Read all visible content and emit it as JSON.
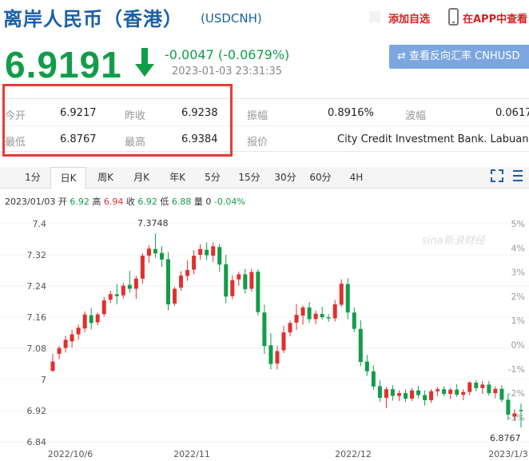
{
  "header": {
    "title": "离岸人民币（香港）",
    "code": "(USDCNH)",
    "add_favorite": "添加自选",
    "app_link": "在APP中查看"
  },
  "price": {
    "last": "6.9191",
    "change": "-0.0047 (-0.0679%)",
    "timestamp": "2023-01-03 23:31:35",
    "direction": "down"
  },
  "reverse_button": "⇄ 查看反向汇率 CNHUSD",
  "quote": {
    "open_label": "今开",
    "open": "6.9217",
    "prev_close_label": "昨收",
    "prev_close": "6.9238",
    "amplitude_label": "振幅",
    "amplitude": "0.8916%",
    "volatility_label": "波幅",
    "volatility": "0.0617",
    "low_label": "最低",
    "low": "6.8767",
    "high_label": "最高",
    "high": "6.9384",
    "quote_label": "报价",
    "quoter": "City Credit Investment Bank. Labuan"
  },
  "tabs": [
    "1分",
    "日K",
    "周K",
    "月K",
    "年K",
    "5分",
    "15分",
    "30分",
    "60分",
    "4H"
  ],
  "active_tab": 1,
  "ohlc_bar": {
    "date": "2023/01/03",
    "open_label": "开",
    "open": "6.92",
    "high_label": "高",
    "high": "6.94",
    "close_label": "收",
    "close": "6.92",
    "low_label": "低",
    "low": "6.88",
    "vol_label": "量",
    "vol": "0",
    "pct": "-0.04%"
  },
  "colors": {
    "up": "#e03030",
    "down": "#129c4a",
    "accent": "#1a5fa8"
  },
  "chart_data": {
    "type": "candlestick",
    "y_ticks": [
      "7.4",
      "7.32",
      "7.24",
      "7.16",
      "7.08",
      "7",
      "6.92",
      "6.84"
    ],
    "pct_ticks": [
      "5%",
      "4%",
      "3%",
      "2%",
      "1%",
      "0%",
      "-1%",
      "-2%",
      "-3%"
    ],
    "x_ticks": [
      "2022/10/6",
      "2022/11",
      "2022/12",
      "2023/1/3"
    ],
    "max_label": "7.3748",
    "min_label": "6.8767",
    "watermark": "sina新浪财经",
    "ylim": [
      6.84,
      7.4
    ],
    "candles": [
      [
        7.022,
        7.066,
        7.02,
        7.046
      ],
      [
        7.066,
        7.086,
        7.052,
        7.081
      ],
      [
        7.081,
        7.112,
        7.069,
        7.102
      ],
      [
        7.098,
        7.128,
        7.082,
        7.116
      ],
      [
        7.116,
        7.141,
        7.102,
        7.133
      ],
      [
        7.131,
        7.175,
        7.122,
        7.167
      ],
      [
        7.165,
        7.183,
        7.129,
        7.145
      ],
      [
        7.147,
        7.172,
        7.139,
        7.167
      ],
      [
        7.168,
        7.212,
        7.161,
        7.203
      ],
      [
        7.205,
        7.228,
        7.196,
        7.219
      ],
      [
        7.219,
        7.245,
        7.193,
        7.214
      ],
      [
        7.216,
        7.248,
        7.208,
        7.241
      ],
      [
        7.243,
        7.279,
        7.223,
        7.233
      ],
      [
        7.233,
        7.266,
        7.207,
        7.259
      ],
      [
        7.259,
        7.324,
        7.246,
        7.318
      ],
      [
        7.318,
        7.345,
        7.3,
        7.336
      ],
      [
        7.335,
        7.375,
        7.313,
        7.324
      ],
      [
        7.325,
        7.342,
        7.289,
        7.308
      ],
      [
        7.309,
        7.327,
        7.178,
        7.193
      ],
      [
        7.195,
        7.238,
        7.189,
        7.233
      ],
      [
        7.236,
        7.278,
        7.228,
        7.267
      ],
      [
        7.266,
        7.306,
        7.253,
        7.281
      ],
      [
        7.282,
        7.332,
        7.27,
        7.318
      ],
      [
        7.32,
        7.347,
        7.308,
        7.335
      ],
      [
        7.333,
        7.352,
        7.307,
        7.319
      ],
      [
        7.318,
        7.352,
        7.302,
        7.342
      ],
      [
        7.34,
        7.348,
        7.276,
        7.295
      ],
      [
        7.296,
        7.32,
        7.196,
        7.213
      ],
      [
        7.214,
        7.268,
        7.206,
        7.255
      ],
      [
        7.257,
        7.277,
        7.241,
        7.27
      ],
      [
        7.27,
        7.284,
        7.221,
        7.232
      ],
      [
        7.233,
        7.284,
        7.226,
        7.276
      ],
      [
        7.277,
        7.283,
        7.165,
        7.173
      ],
      [
        7.172,
        7.192,
        7.066,
        7.086
      ],
      [
        7.088,
        7.119,
        7.026,
        7.04
      ],
      [
        7.041,
        7.087,
        7.026,
        7.073
      ],
      [
        7.075,
        7.138,
        7.068,
        7.121
      ],
      [
        7.121,
        7.151,
        7.111,
        7.145
      ],
      [
        7.146,
        7.194,
        7.127,
        7.166
      ],
      [
        7.164,
        7.19,
        7.141,
        7.185
      ],
      [
        7.185,
        7.199,
        7.146,
        7.155
      ],
      [
        7.155,
        7.177,
        7.142,
        7.169
      ],
      [
        7.168,
        7.186,
        7.154,
        7.16
      ],
      [
        7.16,
        7.168,
        7.148,
        7.157
      ],
      [
        7.157,
        7.204,
        7.149,
        7.193
      ],
      [
        7.192,
        7.257,
        7.186,
        7.246
      ],
      [
        7.245,
        7.26,
        7.155,
        7.172
      ],
      [
        7.172,
        7.185,
        7.122,
        7.13
      ],
      [
        7.13,
        7.152,
        7.034,
        7.045
      ],
      [
        7.046,
        7.063,
        7.009,
        7.021
      ],
      [
        7.021,
        7.036,
        6.973,
        6.982
      ],
      [
        6.983,
        6.998,
        6.943,
        6.953
      ],
      [
        6.953,
        6.981,
        6.926,
        6.975
      ],
      [
        6.975,
        6.985,
        6.946,
        6.958
      ],
      [
        6.958,
        6.972,
        6.945,
        6.965
      ],
      [
        6.965,
        6.975,
        6.943,
        6.951
      ],
      [
        6.951,
        6.978,
        6.945,
        6.972
      ],
      [
        6.972,
        6.984,
        6.952,
        6.96
      ],
      [
        6.96,
        6.972,
        6.933,
        6.947
      ],
      [
        6.947,
        6.975,
        6.94,
        6.97
      ],
      [
        6.97,
        6.98,
        6.957,
        6.975
      ],
      [
        6.975,
        6.983,
        6.957,
        6.963
      ],
      [
        6.963,
        6.978,
        6.95,
        6.974
      ],
      [
        6.974,
        6.988,
        6.955,
        6.961
      ],
      [
        6.961,
        6.975,
        6.947,
        6.968
      ],
      [
        6.968,
        6.996,
        6.96,
        6.992
      ],
      [
        6.992,
        6.998,
        6.97,
        6.978
      ],
      [
        6.978,
        6.996,
        6.963,
        6.987
      ],
      [
        6.987,
        6.996,
        6.958,
        6.965
      ],
      [
        6.965,
        6.982,
        6.952,
        6.976
      ],
      [
        6.976,
        6.985,
        6.942,
        6.948
      ],
      [
        6.948,
        6.964,
        6.896,
        6.91
      ],
      [
        6.905,
        6.923,
        6.893,
        6.913
      ],
      [
        6.922,
        6.938,
        6.877,
        6.919
      ]
    ]
  }
}
